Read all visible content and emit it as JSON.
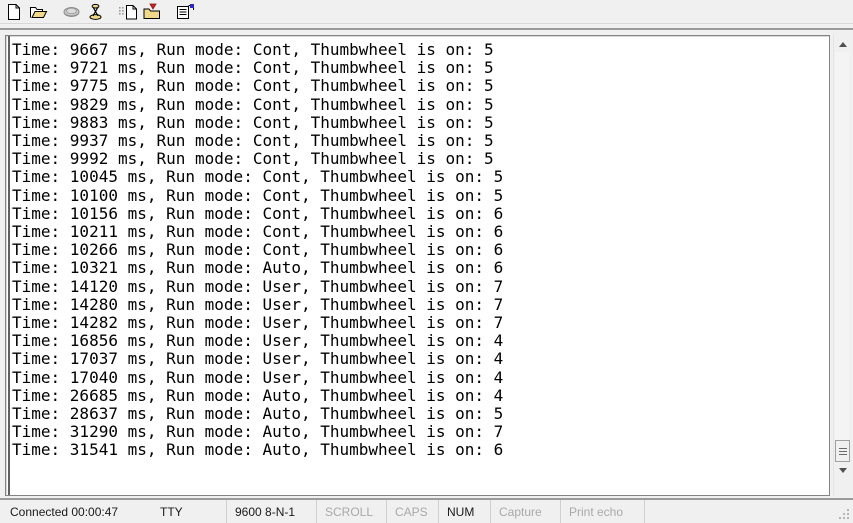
{
  "window": {
    "background": "#f0f0f0",
    "terminal_background": "#ffffff",
    "terminal_text_color": "#000000"
  },
  "toolbar": {
    "buttons": [
      {
        "name": "new-icon",
        "label": "New"
      },
      {
        "name": "open-folder-icon",
        "label": "Open"
      },
      {
        "name": "telephone-icon",
        "label": "Connect"
      },
      {
        "name": "disconnect-icon",
        "label": "Disconnect"
      },
      {
        "name": "receive-file-icon",
        "label": "Receive data"
      },
      {
        "name": "send-file-icon",
        "label": "Send file"
      },
      {
        "name": "properties-icon",
        "label": "Properties"
      }
    ]
  },
  "terminal": {
    "lines": [
      "Time: 9667 ms, Run mode: Cont, Thumbwheel is on: 5",
      "Time: 9721 ms, Run mode: Cont, Thumbwheel is on: 5",
      "Time: 9775 ms, Run mode: Cont, Thumbwheel is on: 5",
      "Time: 9829 ms, Run mode: Cont, Thumbwheel is on: 5",
      "Time: 9883 ms, Run mode: Cont, Thumbwheel is on: 5",
      "Time: 9937 ms, Run mode: Cont, Thumbwheel is on: 5",
      "Time: 9992 ms, Run mode: Cont, Thumbwheel is on: 5",
      "Time: 10045 ms, Run mode: Cont, Thumbwheel is on: 5",
      "Time: 10100 ms, Run mode: Cont, Thumbwheel is on: 5",
      "Time: 10156 ms, Run mode: Cont, Thumbwheel is on: 6",
      "Time: 10211 ms, Run mode: Cont, Thumbwheel is on: 6",
      "Time: 10266 ms, Run mode: Cont, Thumbwheel is on: 6",
      "Time: 10321 ms, Run mode: Auto, Thumbwheel is on: 6",
      "Time: 14120 ms, Run mode: User, Thumbwheel is on: 7",
      "Time: 14280 ms, Run mode: User, Thumbwheel is on: 7",
      "Time: 14282 ms, Run mode: User, Thumbwheel is on: 7",
      "Time: 16856 ms, Run mode: User, Thumbwheel is on: 4",
      "Time: 17037 ms, Run mode: User, Thumbwheel is on: 4",
      "Time: 17040 ms, Run mode: User, Thumbwheel is on: 4",
      "Time: 26685 ms, Run mode: Auto, Thumbwheel is on: 4",
      "Time: 28637 ms, Run mode: Auto, Thumbwheel is on: 5",
      "Time: 31290 ms, Run mode: Auto, Thumbwheel is on: 7",
      "Time: 31541 ms, Run mode: Auto, Thumbwheel is on: 6"
    ]
  },
  "scrollbar": {
    "up_arrow": "scroll-up",
    "down_arrow": "scroll-down"
  },
  "statusbar": {
    "connection": "Connected 00:00:47",
    "emulation": "TTY",
    "port_settings": "9600 8-N-1",
    "indicators": [
      {
        "label": "SCROLL",
        "active": false
      },
      {
        "label": "CAPS",
        "active": false
      },
      {
        "label": "NUM",
        "active": true
      },
      {
        "label": "Capture",
        "active": false
      },
      {
        "label": "Print echo",
        "active": false
      }
    ]
  }
}
